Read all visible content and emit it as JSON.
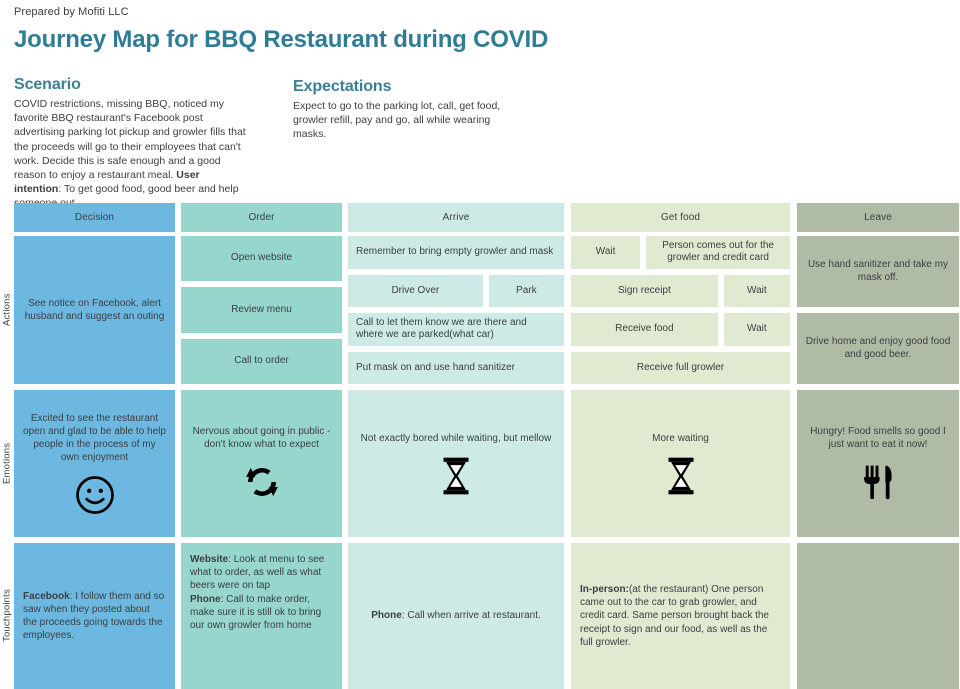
{
  "header": {
    "prepared_by": "Prepared by Mofiti LLC",
    "title": "Journey Map for BBQ Restaurant during COVID",
    "title_color": "#2f7d95"
  },
  "intro": {
    "scenario": {
      "heading": "Scenario",
      "body": "COVID restrictions, missing BBQ, noticed my favorite BBQ restaurant's Facebook post advertising parking lot pickup and growler fills that the proceeds will go to their employees that can't work. Decide this is safe enough and a good reason to enjoy a restaurant meal.",
      "intention_label": "User intention",
      "intention_body": ": To get good food, good beer and help someone out."
    },
    "expectations": {
      "heading": "Expectations",
      "body": "Expect to go to the parking lot, call, get food, growler refill, pay and go, all while wearing masks."
    }
  },
  "row_labels": {
    "actions": "Actions",
    "emotions": "Emotions",
    "touchpoints": "Touchpoints"
  },
  "colors": {
    "c1": "#6cb8e0",
    "c2": "#96d6cd",
    "c3": "#cdeae6",
    "c4": "#dfead0",
    "c5": "#b0bba6"
  },
  "phases": [
    {
      "label": "Decision"
    },
    {
      "label": "Order"
    },
    {
      "label": "Arrive"
    },
    {
      "label": "Get food"
    },
    {
      "label": "Leave"
    }
  ],
  "actions": {
    "decision": "See notice on Facebook, alert husband  and suggest an outing",
    "order": [
      "Open website",
      "Review menu",
      "Call to order"
    ],
    "arrive": {
      "r1": "Remember to bring empty growler and mask",
      "r2a": "Drive Over",
      "r2b": "Park",
      "r3": "Call to let them know we are there and where we are parked(what car)",
      "r4": "Put mask on and use hand sanitizer"
    },
    "getfood": {
      "r1a": "Wait",
      "r1b": "Person comes out for the growler and credit card",
      "r2a": "Sign receipt",
      "r2b": "Wait",
      "r3a": "Receive food",
      "r3b": "Wait",
      "r4": "Receive full growler"
    },
    "leave": {
      "r1": "Use hand sanitizer and take my mask off.",
      "r2": "Drive home and enjoy good food and good beer."
    }
  },
  "emotions": [
    {
      "text": "Excited to see the restaurant open and glad to be able to help people in the process of my own enjoyment",
      "icon": "smiley-face-icon"
    },
    {
      "text": "Nervous about going in public - don't know what to expect",
      "icon": "refresh-cycle-icon"
    },
    {
      "text": "Not exactly bored while waiting, but mellow",
      "icon": "hourglass-icon"
    },
    {
      "text": "More waiting",
      "icon": "hourglass-icon"
    },
    {
      "text": "Hungry! Food smells so good I just want to eat it now!",
      "icon": "fork-knife-icon"
    }
  ],
  "touchpoints": {
    "decision": {
      "label": "Facebook",
      "body": ": I follow them and so saw when they posted about the proceeds going towards the employees."
    },
    "order": {
      "label1": "Website",
      "body1": ": Look at menu to see what to order, as well as what beers were on tap",
      "label2": "Phone",
      "body2": ": Call to make order, make sure it is still ok to bring our own growler from home"
    },
    "arrive": {
      "label": "Phone",
      "body": ": Call when arrive at restaurant."
    },
    "getfood": {
      "label": "In-person:",
      "body": "(at the restaurant) One person came out to the car to grab growler, and credit card. Same person brought back the receipt to sign and our food, as well as the full growler."
    },
    "leave": {
      "label": "",
      "body": ""
    }
  }
}
